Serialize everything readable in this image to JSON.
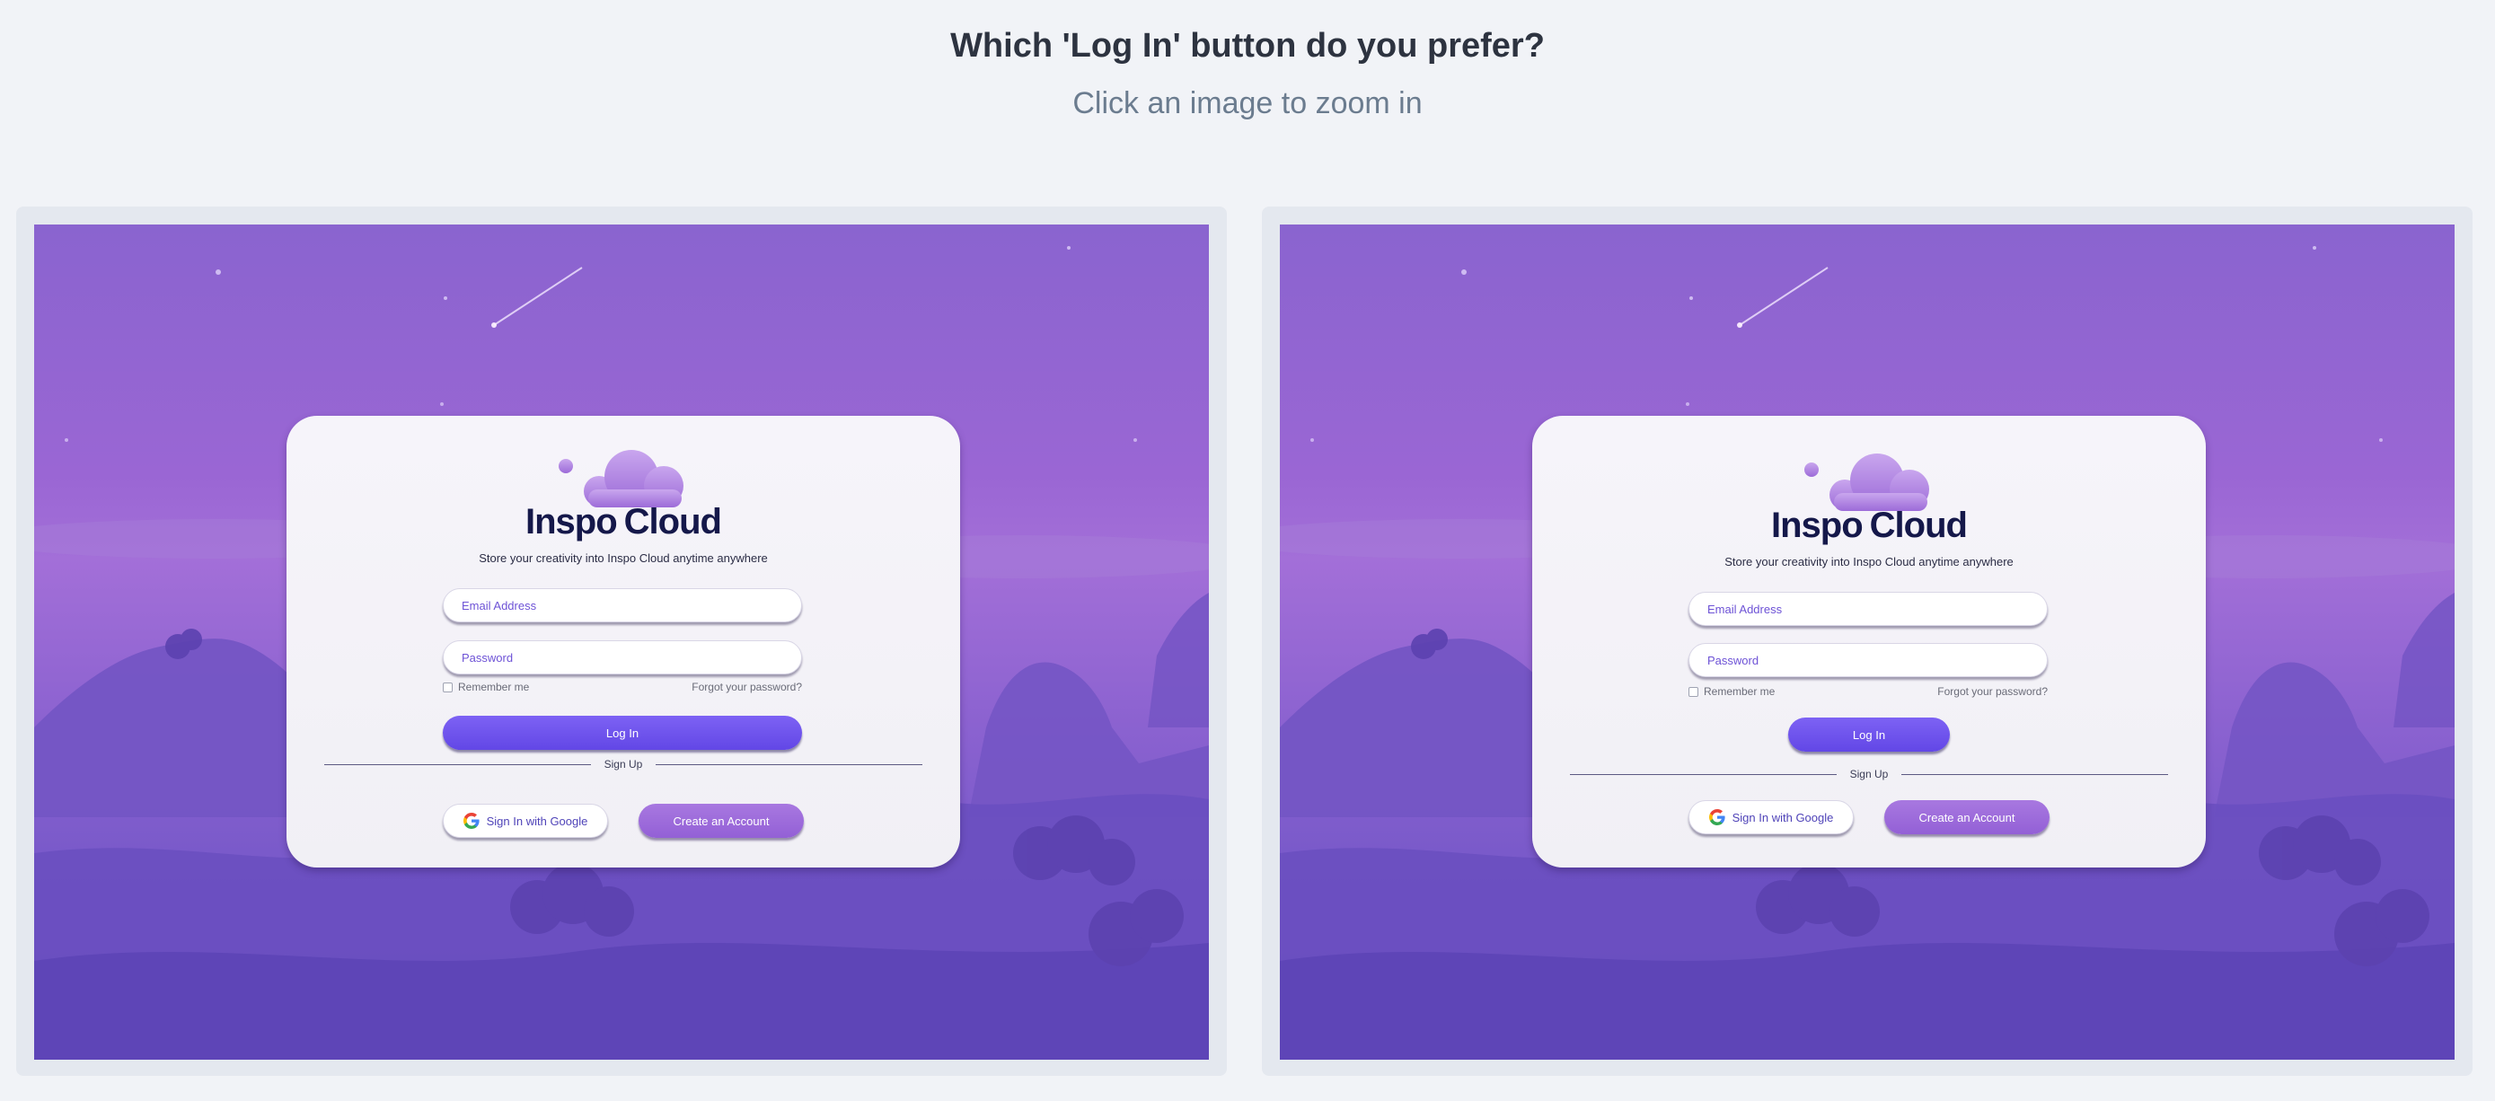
{
  "header": {
    "title": "Which 'Log In' button do you prefer?",
    "subtitle": "Click an image to zoom in"
  },
  "options": [
    {
      "brand_word1": "Inspo",
      "brand_word2": "Cloud",
      "tagline": "Store your creativity into Inspo Cloud anytime anywhere",
      "email_placeholder": "Email Address",
      "password_placeholder": "Password",
      "remember_label": "Remember me",
      "forgot_label": "Forgot your password?",
      "login_label": "Log In",
      "login_button_style": "full-width",
      "signup_label": "Sign Up",
      "google_label": "Sign In with Google",
      "create_label": "Create an Account"
    },
    {
      "brand_word1": "Inspo",
      "brand_word2": "Cloud",
      "tagline": "Store your creativity into Inspo Cloud anytime anywhere",
      "email_placeholder": "Email Address",
      "password_placeholder": "Password",
      "remember_label": "Remember me",
      "forgot_label": "Forgot your password?",
      "login_label": "Log In",
      "login_button_style": "compact",
      "signup_label": "Sign Up",
      "google_label": "Sign In with Google",
      "create_label": "Create an Account"
    }
  ],
  "colors": {
    "page_background": "#f1f3f7",
    "login_button": "#6b50ee",
    "create_button": "#a070dc",
    "brand_text": "#15184a",
    "background_purple": "#8b62d0"
  },
  "icons": [
    "cloud-logo-icon",
    "google-icon",
    "shooting-star",
    "mountain-silhouette"
  ]
}
